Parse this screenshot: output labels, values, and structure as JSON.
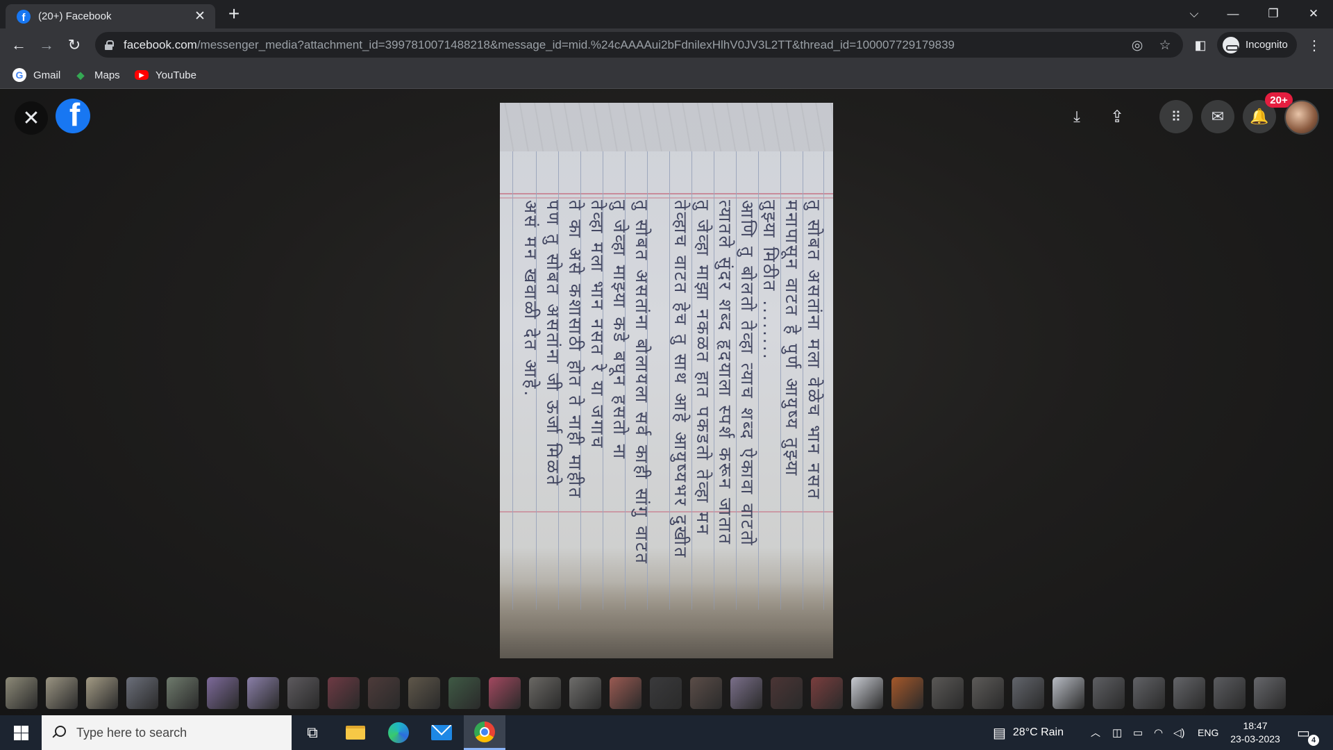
{
  "browser": {
    "tab_title": "(20+) Facebook",
    "url_host": "facebook.com",
    "url_path": "/messenger_media?attachment_id=3997810071488218&message_id=mid.%24cAAAAui2bFdnilexHlhV0JV3L2TT&thread_id=100007729179839",
    "incognito_label": "Incognito",
    "bookmarks": [
      "Gmail",
      "Maps",
      "YouTube"
    ]
  },
  "viewer": {
    "notification_badge": "20+",
    "handwritten_lines": [
      "तु सोबत असतांना मला वेळेच भान नसत",
      "मनापासून वाटत हे पुर्ण आयुष्य तुझ्या",
      "तुझ्या मिठीत ........",
      "आणि तु बोलतो तेव्हा त्याच शब्द ऐकावा वाटतो",
      "त्यातले सुंदर शब्द हृदयाला स्पर्श करून जातात",
      "तु जेव्हा माझा नकळत हात पकडतो तेव्हा मन",
      "तेव्हाच वाटत हेच तु साथ आहे आयुष्यभर दुखीत",
      "तु सोबत असतांना बोलायला सर्व काही सांगु वाटत",
      "तु जेव्हा माझ्या कडे बघून हसतो ना",
      "तेव्हा मला भान नसत रे या जगाच",
      "ते का असे कशासाठी होत ते नाही माहीत",
      "पण तु सोबत असतांना जी ऊर्जा मिळते",
      "असं मन खवाळी देत आहे."
    ],
    "thumbnail_colors": [
      "#8d8a78",
      "#9a9482",
      "#a39b85",
      "#6b6f7a",
      "#6f7b6d",
      "#7d6a9a",
      "#8a7fa8",
      "#5d5a5e",
      "#6e3a44",
      "#4d3b3a",
      "#5f574a",
      "#3f5a45",
      "#a2485f",
      "#6a6864",
      "#6e6d6b",
      "#9a5a52",
      "#3a3a3c",
      "#5b4d48",
      "#7a6f8a",
      "#4b3535",
      "#7a3e3e",
      "#c9ccd3",
      "#a5582a",
      "#5a5856",
      "#5d5b59",
      "#62656c",
      "#b8bcc4",
      "#5e5f63",
      "#616266",
      "#646569",
      "#5b5c60",
      "#66676b"
    ]
  },
  "taskbar": {
    "search_placeholder": "Type here to search",
    "weather": "28°C  Rain",
    "language": "ENG",
    "time": "18:47",
    "date": "23-03-2023",
    "notification_count": "4"
  }
}
